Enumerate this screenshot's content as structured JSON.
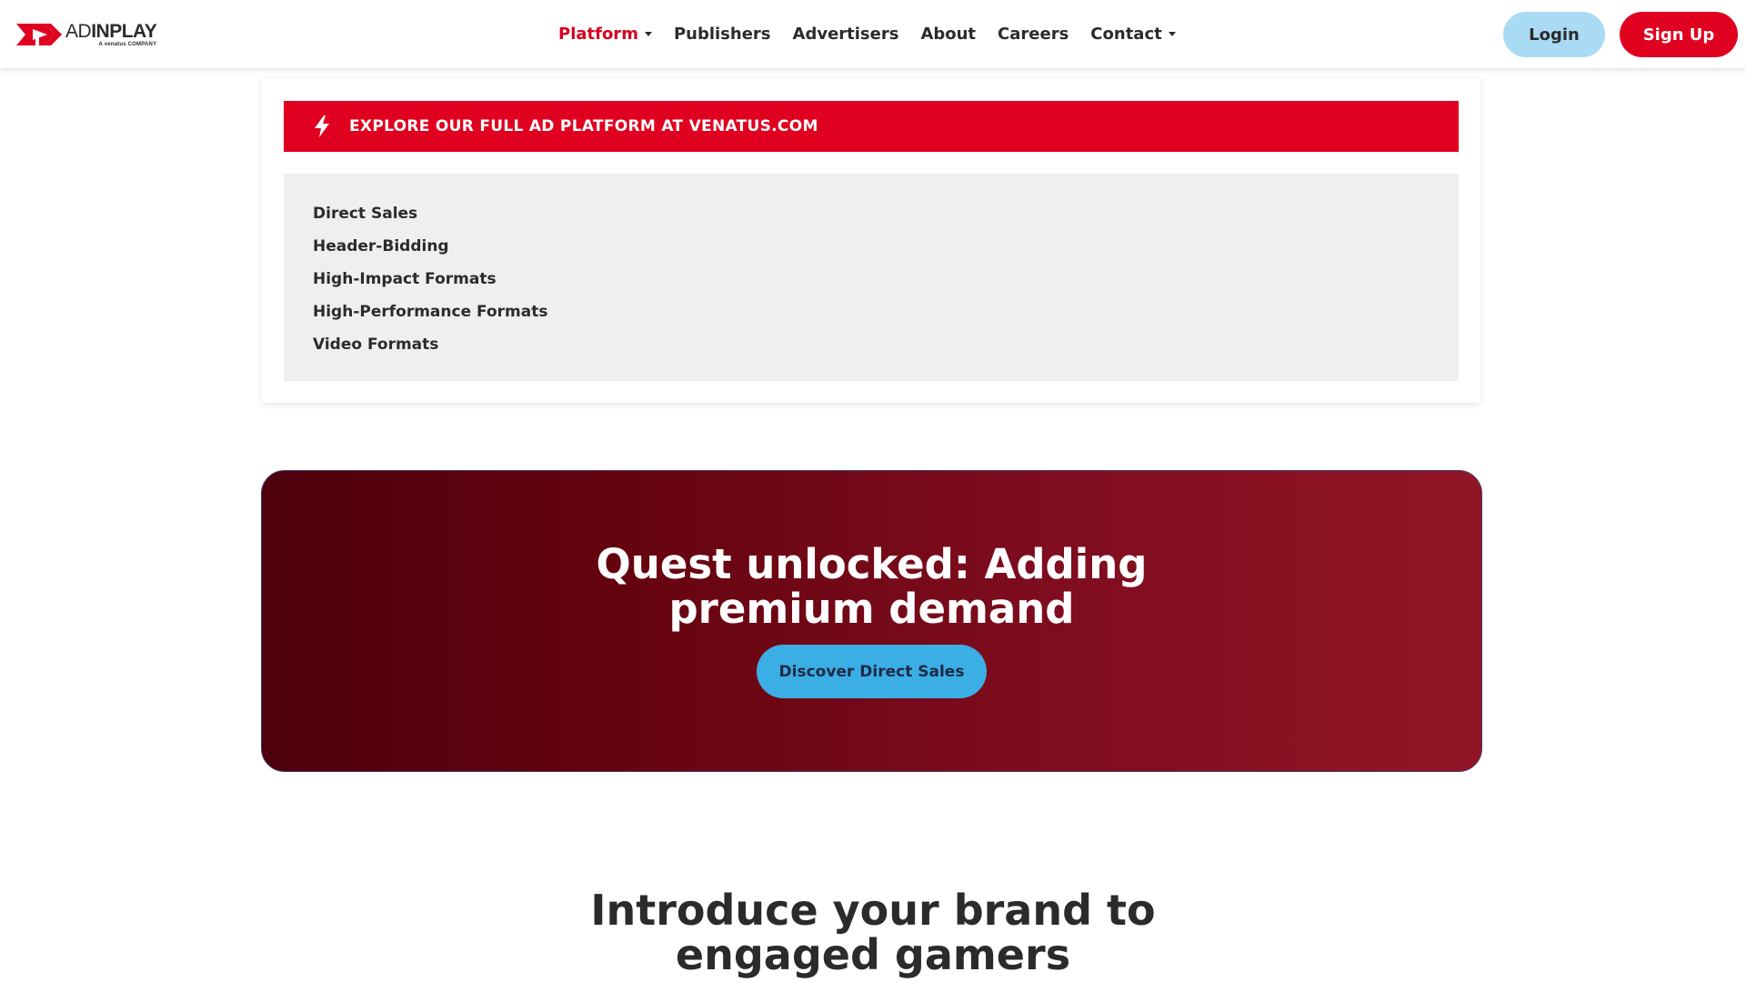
{
  "brand": {
    "logo_thin": "AD",
    "logo_bold": "INPLAY",
    "logo_sub": "A venatus COMPANY",
    "accent": "#e0001f"
  },
  "nav": {
    "items": [
      {
        "label": "Platform",
        "dropdown": true,
        "active": true
      },
      {
        "label": "Publishers",
        "dropdown": false
      },
      {
        "label": "Advertisers",
        "dropdown": false
      },
      {
        "label": "About",
        "dropdown": false
      },
      {
        "label": "Careers",
        "dropdown": false
      },
      {
        "label": "Contact",
        "dropdown": true
      }
    ],
    "login_label": "Login",
    "signup_label": "Sign Up"
  },
  "platform_menu": {
    "banner_icon": "bolt-icon",
    "banner_text": "EXPLORE OUR FULL AD PLATFORM AT VENATUS.COM",
    "items": [
      "Direct Sales",
      "Header-Bidding",
      "High-Impact Formats",
      "High-Performance Formats",
      "Video Formats"
    ]
  },
  "promo": {
    "title": "Quest unlocked: Adding premium demand",
    "button_label": "Discover Direct Sales"
  },
  "intro": {
    "title": "Introduce your brand to engaged gamers"
  }
}
